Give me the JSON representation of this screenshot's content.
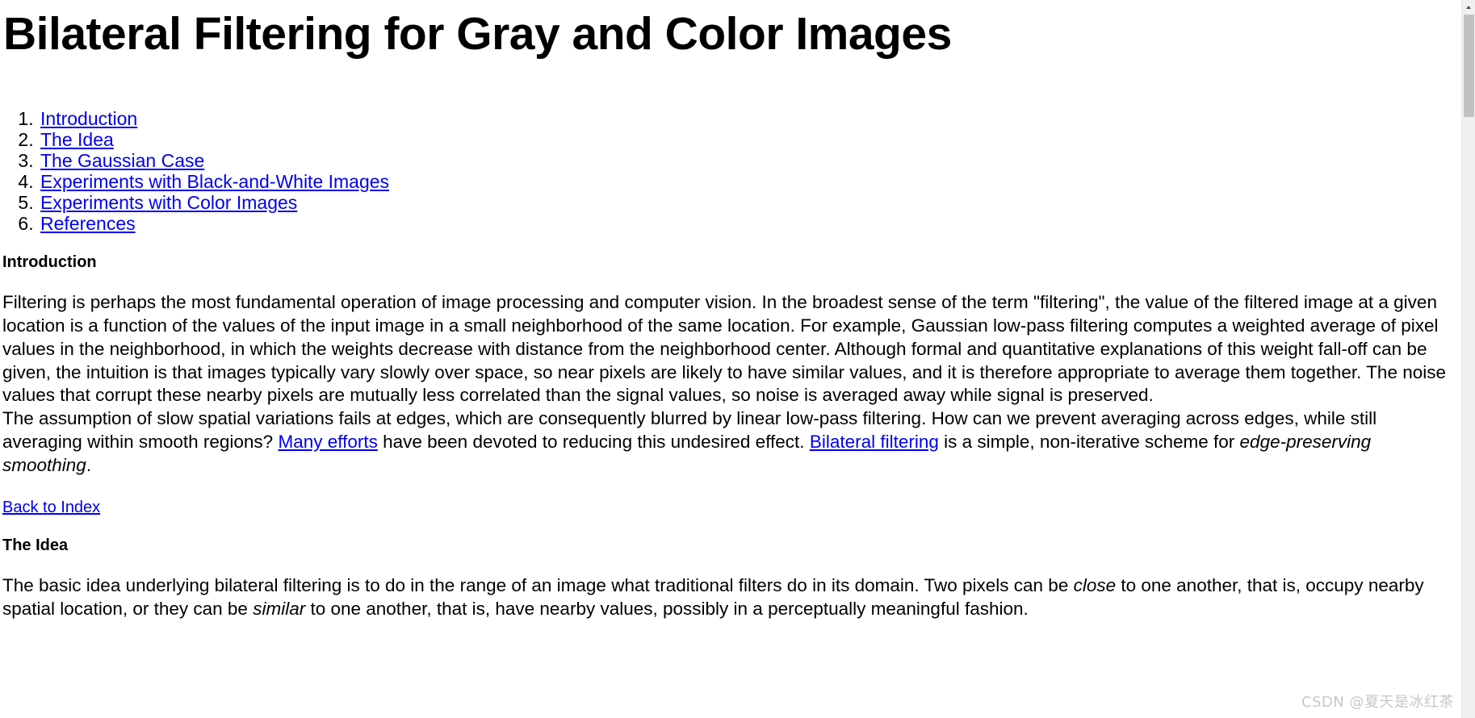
{
  "document": {
    "title": "Bilateral Filtering for Gray and Color Images",
    "toc": [
      {
        "label": "Introduction"
      },
      {
        "label": "The Idea"
      },
      {
        "label": "The Gaussian Case"
      },
      {
        "label": "Experiments with Black-and-White Images"
      },
      {
        "label": "Experiments with Color Images"
      },
      {
        "label": "References"
      }
    ],
    "sections": [
      {
        "heading": "Introduction",
        "paragraph1": "Filtering is perhaps the most fundamental operation of image processing and computer vision. In the broadest sense of the term \"filtering\", the value of the filtered image at a given location is a function of the values of the input image in a small neighborhood of the same location. For example, Gaussian low-pass filtering computes a weighted average of pixel values in the neighborhood, in which the weights decrease with distance from the neighborhood center. Although formal and quantitative explanations of this weight fall-off can be given, the intuition is that images typically vary slowly over space, so near pixels are likely to have similar values, and it is therefore appropriate to average them together. The noise values that corrupt these nearby pixels are mutually less correlated than the signal values, so noise is averaged away while signal is preserved.",
        "paragraph2_part1": "The assumption of slow spatial variations fails at edges, which are consequently blurred by linear low-pass filtering. How can we prevent averaging across edges, while still averaging within smooth regions? ",
        "paragraph2_link1": "Many efforts",
        "paragraph2_part2": " have been devoted to reducing this undesired effect. ",
        "paragraph2_link2": "Bilateral filtering",
        "paragraph2_part3": " is a simple, non-iterative scheme for ",
        "paragraph2_italic": "edge-preserving smoothing",
        "paragraph2_part4": ".",
        "back_link": "Back to Index"
      },
      {
        "heading": "The Idea",
        "paragraph1_part1": "The basic idea underlying bilateral filtering is to do in the range of an image what traditional filters do in its domain. Two pixels can be ",
        "paragraph1_italic1": "close",
        "paragraph1_part2": " to one another, that is, occupy nearby spatial location, or they can be ",
        "paragraph1_italic2": "similar",
        "paragraph1_part3": " to one another, that is, have nearby values, possibly in a perceptually meaningful fashion."
      }
    ]
  },
  "watermark": "CSDN @夏天是冰红茶",
  "colors": {
    "link": "#0000EE",
    "text": "#000000",
    "background": "#FFFFFF",
    "scrollbar_track": "#F0F0F0",
    "scrollbar_thumb": "#C1C1C1",
    "watermark": "#C8C8C8"
  }
}
